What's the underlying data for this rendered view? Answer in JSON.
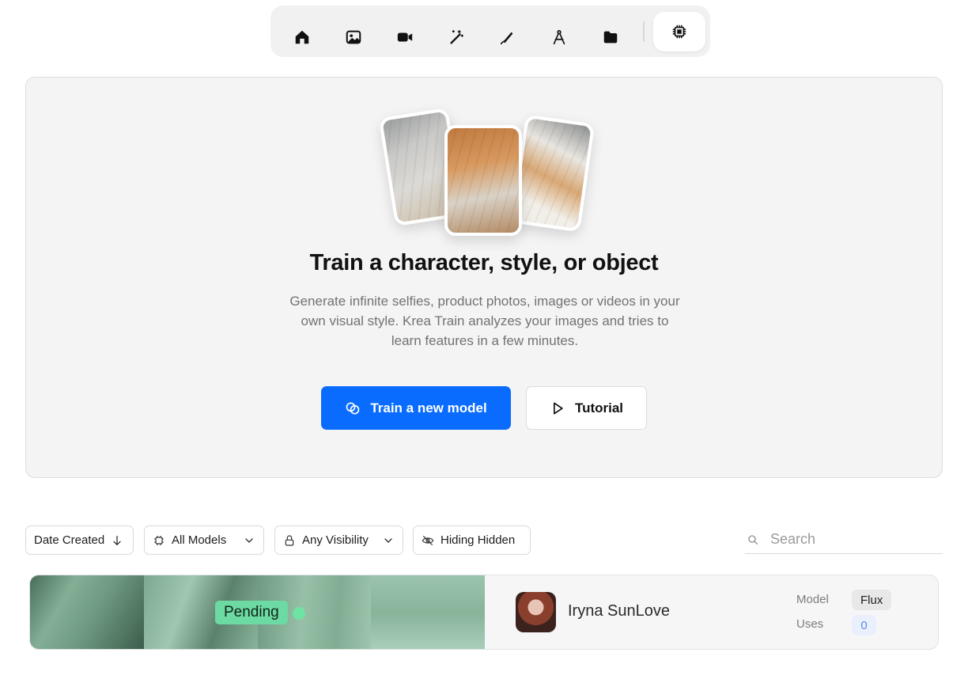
{
  "toolbar": {
    "items": [
      {
        "icon": "home-icon"
      },
      {
        "icon": "image-icon"
      },
      {
        "icon": "video-icon"
      },
      {
        "icon": "magic-wand-icon"
      },
      {
        "icon": "pen-icon"
      },
      {
        "icon": "compass-icon"
      },
      {
        "icon": "folder-icon"
      },
      {
        "icon": "chip-icon",
        "active": true
      }
    ]
  },
  "hero": {
    "title": "Train a character, style, or object",
    "description": "Generate infinite selfies, product photos, images or videos in your own visual style. Krea Train analyzes your images and tries to learn features in a few minutes.",
    "primary_button": "Train a new model",
    "secondary_button": "Tutorial",
    "accent_color": "#0a6cff"
  },
  "filters": {
    "sort": "Date Created",
    "models": "All Models",
    "visibility": "Any Visibility",
    "hidden": "Hiding Hidden"
  },
  "search": {
    "placeholder": "Search"
  },
  "models": [
    {
      "status": "Pending",
      "name": "Iryna SunLove",
      "model_label": "Model",
      "model_value": "Flux",
      "uses_label": "Uses",
      "uses_value": "0"
    }
  ]
}
